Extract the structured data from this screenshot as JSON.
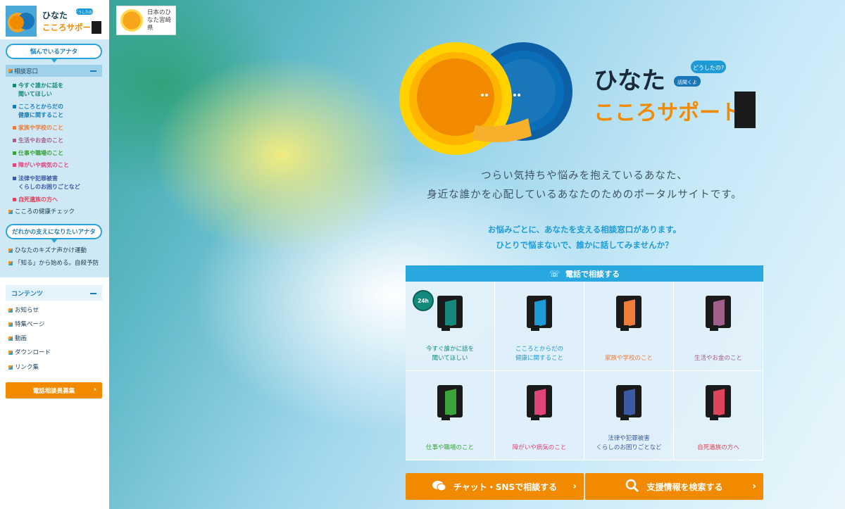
{
  "colors": {
    "accent_blue": "#29a7df",
    "accent_orange": "#f28a00",
    "sidebar_panel": "#cfe8f5"
  },
  "site": {
    "logo_line1": "ひなた",
    "logo_line2": "こころサポート",
    "logo_bubble": "どうしたの?",
    "hero_bubble1": "どうしたの?",
    "hero_bubble2": "話聞くよ",
    "pref_badge": "日本のひなた宮崎県"
  },
  "sidebar": {
    "section1_label": "悩んでいるアナタ",
    "category_label": "相談窓口",
    "consult_items": [
      {
        "label": "今すぐ誰かに話を\n聞いてほしい",
        "color": "#15897b"
      },
      {
        "label": "こころとからだの\n健康に関すること",
        "color": "#1b7cb7"
      },
      {
        "label": "家族や学校のこと",
        "color": "#ef7d3a"
      },
      {
        "label": "生活やお金のこと",
        "color": "#a0608b"
      },
      {
        "label": "仕事や職場のこと",
        "color": "#3aa43a"
      },
      {
        "label": "障がいや病気のこと",
        "color": "#e0447b"
      },
      {
        "label": "法律や犯罪被害\nくらしのお困りごとなど",
        "color": "#3a5aa4"
      },
      {
        "label": "自死遺族の方へ",
        "color": "#e0445a"
      }
    ],
    "health_check": "こころの健康チェック",
    "section2_label": "だれかの支えになりたいアナタ",
    "support_items": [
      "ひなたのキズナ声かけ運動",
      "「知る」から始める。自殺予防"
    ],
    "contents_label": "コンテンツ",
    "contents_items": [
      "お知らせ",
      "特集ページ",
      "動画",
      "ダウンロード",
      "リンク集"
    ],
    "recruit_button": "電話相談員募集"
  },
  "main": {
    "tagline_line1": "つらい気持ちや悩みを抱えているあなた、",
    "tagline_line2": "身近な誰かを心配しているあなたのためのポータルサイトです。",
    "sub_line1": "お悩みごとに、あなたを支える相談窓口があります。",
    "sub_line2": "ひとりで悩まないで、誰かに話してみませんか？",
    "phone_header": "電話で相談する",
    "badge_24h": "24h",
    "tiles": [
      {
        "label": "今すぐ誰かに話を\n聞いてほしい",
        "color": "#15897b",
        "icon": "door-icon",
        "badge": true
      },
      {
        "label": "こころとからだの\n健康に関すること",
        "color": "#1e9bd7",
        "icon": "door-icon"
      },
      {
        "label": "家族や学校のこと",
        "color": "#ef7d3a",
        "icon": "door-icon"
      },
      {
        "label": "生活やお金のこと",
        "color": "#a0608b",
        "icon": "door-icon"
      },
      {
        "label": "仕事や職場のこと",
        "color": "#3aa43a",
        "icon": "door-icon"
      },
      {
        "label": "障がいや病気のこと",
        "color": "#e0447b",
        "icon": "door-icon"
      },
      {
        "label": "法律や犯罪被害\nくらしのお困りごとなど",
        "color": "#3a5aa4",
        "icon": "door-icon"
      },
      {
        "label": "自死遺族の方へ",
        "color": "#e0445a",
        "icon": "door-icon"
      }
    ],
    "chat_button": "チャット・SNSで相談する",
    "search_button": "支援情報を検索する"
  }
}
